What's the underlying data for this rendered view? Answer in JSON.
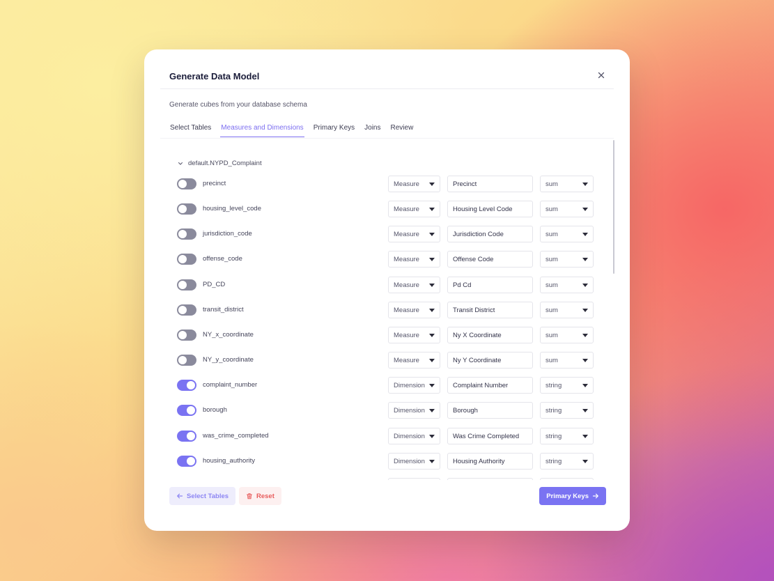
{
  "modal": {
    "title": "Generate Data Model",
    "subtitle": "Generate cubes from your database schema"
  },
  "tabs": [
    {
      "label": "Select Tables",
      "active": false
    },
    {
      "label": "Measures and Dimensions",
      "active": true
    },
    {
      "label": "Primary Keys",
      "active": false
    },
    {
      "label": "Joins",
      "active": false
    },
    {
      "label": "Review",
      "active": false
    }
  ],
  "group": {
    "name": "default.NYPD_Complaint",
    "expanded": true
  },
  "rows": [
    {
      "column": "precinct",
      "enabled": false,
      "type": "Measure",
      "title": "Precinct",
      "aggregation": "sum"
    },
    {
      "column": "housing_level_code",
      "enabled": false,
      "type": "Measure",
      "title": "Housing Level Code",
      "aggregation": "sum"
    },
    {
      "column": "jurisdiction_code",
      "enabled": false,
      "type": "Measure",
      "title": "Jurisdiction Code",
      "aggregation": "sum"
    },
    {
      "column": "offense_code",
      "enabled": false,
      "type": "Measure",
      "title": "Offense Code",
      "aggregation": "sum"
    },
    {
      "column": "PD_CD",
      "enabled": false,
      "type": "Measure",
      "title": "Pd Cd",
      "aggregation": "sum"
    },
    {
      "column": "transit_district",
      "enabled": false,
      "type": "Measure",
      "title": "Transit District",
      "aggregation": "sum"
    },
    {
      "column": "NY_x_coordinate",
      "enabled": false,
      "type": "Measure",
      "title": "Ny X Coordinate",
      "aggregation": "sum"
    },
    {
      "column": "NY_y_coordinate",
      "enabled": false,
      "type": "Measure",
      "title": "Ny Y Coordinate",
      "aggregation": "sum"
    },
    {
      "column": "complaint_number",
      "enabled": true,
      "type": "Dimension",
      "title": "Complaint Number",
      "aggregation": "string"
    },
    {
      "column": "borough",
      "enabled": true,
      "type": "Dimension",
      "title": "Borough",
      "aggregation": "string"
    },
    {
      "column": "was_crime_completed",
      "enabled": true,
      "type": "Dimension",
      "title": "Was Crime Completed",
      "aggregation": "string"
    },
    {
      "column": "housing_authority",
      "enabled": true,
      "type": "Dimension",
      "title": "Housing Authority",
      "aggregation": "string"
    }
  ],
  "footer": {
    "back_label": "Select Tables",
    "reset_label": "Reset",
    "next_label": "Primary Keys"
  },
  "colors": {
    "accent": "#7a73f2",
    "danger": "#e85c5c",
    "toggle_off": "#8a8a9c"
  }
}
